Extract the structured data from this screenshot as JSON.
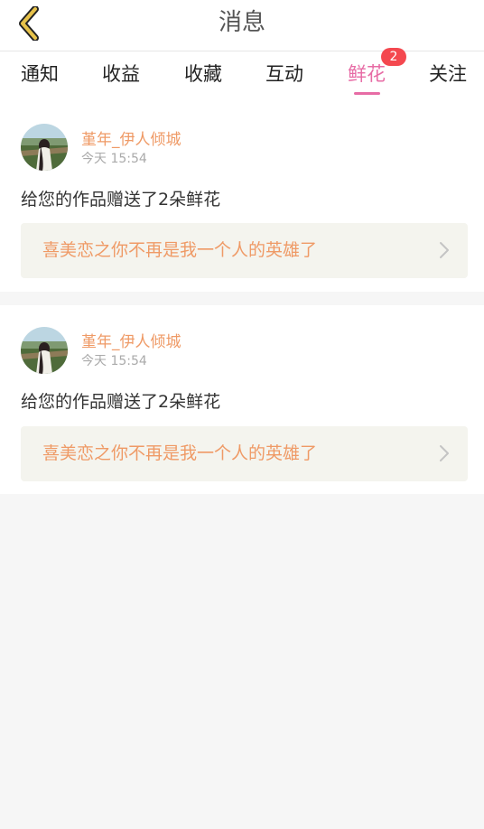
{
  "header": {
    "title": "消息",
    "back_icon": "chevron-left-icon"
  },
  "tabs": [
    {
      "label": "通知"
    },
    {
      "label": "收益"
    },
    {
      "label": "收藏"
    },
    {
      "label": "互动"
    },
    {
      "label": "鲜花",
      "active": true,
      "badge": "2"
    },
    {
      "label": "关注"
    }
  ],
  "messages": [
    {
      "username": "堇年_伊人倾城",
      "time": "今天 15:54",
      "text": "给您的作品赠送了2朵鲜花",
      "work_title": "喜美恋之你不再是我一个人的英雄了",
      "link_icon": "chevron-right-icon"
    },
    {
      "username": "堇年_伊人倾城",
      "time": "今天 15:54",
      "text": "给您的作品赠送了2朵鲜花",
      "work_title": "喜美恋之你不再是我一个人的英雄了",
      "link_icon": "chevron-right-icon"
    }
  ],
  "colors": {
    "accent_pink": "#e76ca5",
    "username_orange": "#ef9a66",
    "badge_red": "#f4484f",
    "back_icon_gold": "#e7c24a",
    "page_background": "#f6f6f6",
    "link_background": "#f4f4ee"
  }
}
